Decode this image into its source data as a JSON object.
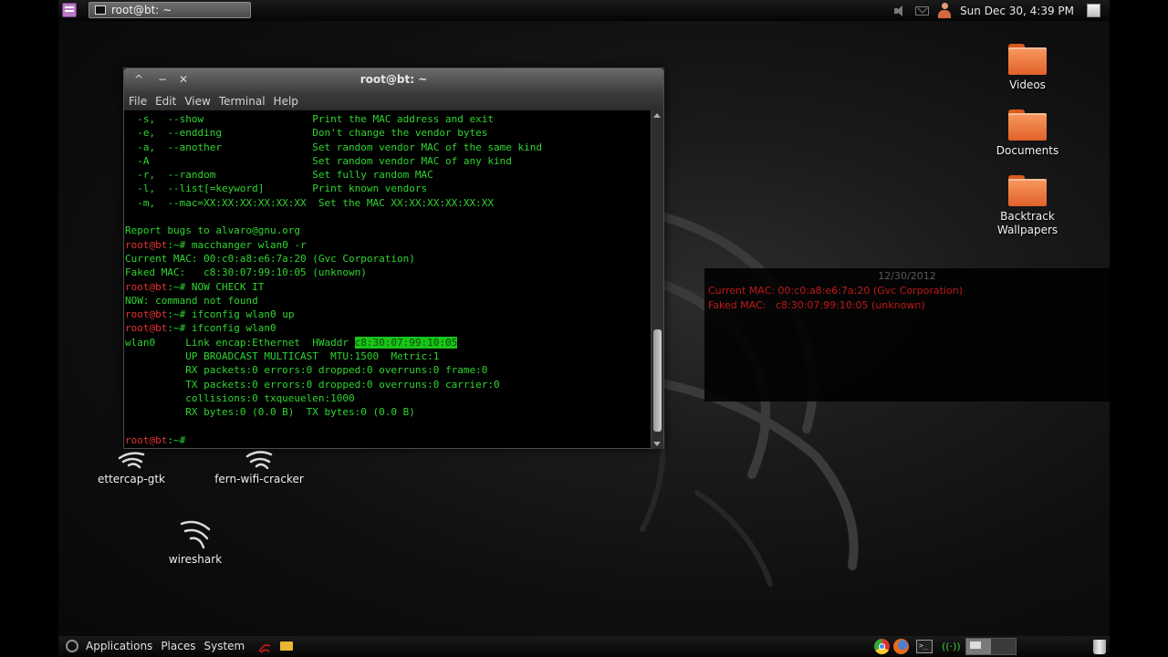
{
  "top_panel": {
    "taskbar_window": "root@bt: ~",
    "clock": "Sun Dec 30,  4:39 PM",
    "icons": [
      "menu-launcher-icon",
      "terminal-icon",
      "speaker-icon",
      "mail-icon",
      "user-icon",
      "show-desktop-icon"
    ]
  },
  "terminal": {
    "title": "root@bt: ~",
    "menu": [
      "File",
      "Edit",
      "View",
      "Terminal",
      "Help"
    ],
    "lines": [
      "  -s,  --show                  Print the MAC address and exit",
      "  -e,  --endding               Don't change the vendor bytes",
      "  -a,  --another               Set random vendor MAC of the same kind",
      "  -A                           Set random vendor MAC of any kind",
      "  -r,  --random                Set fully random MAC",
      "  -l,  --list[=keyword]        Print known vendors",
      "  -m,  --mac=XX:XX:XX:XX:XX:XX  Set the MAC XX:XX:XX:XX:XX:XX",
      "",
      "Report bugs to alvaro@gnu.org"
    ],
    "prompt": "root@bt",
    "prompt_suffix": ":~# ",
    "cmd1": "macchanger wlan0 -r",
    "out1": "Current MAC: 00:c0:a8:e6:7a:20 (Gvc Corporation)",
    "out2": "Faked MAC:   c8:30:07:99:10:05 (unknown)",
    "cmd2": "NOW CHECK IT",
    "out3": "NOW: command not found",
    "cmd3": "ifconfig wlan0 up",
    "cmd4": "ifconfig wlan0",
    "if_pre": "wlan0     Link encap:Ethernet  HWaddr ",
    "hwaddr": "c8:30:07:99:10:05",
    "if_lines": [
      "          UP BROADCAST MULTICAST  MTU:1500  Metric:1",
      "          RX packets:0 errors:0 dropped:0 overruns:0 frame:0",
      "          TX packets:0 errors:0 dropped:0 overruns:0 carrier:0",
      "          collisions:0 txqueuelen:1000",
      "          RX bytes:0 (0.0 B)  TX bytes:0 (0.0 B)"
    ]
  },
  "conky": {
    "date": "12/30/2012",
    "line1": "Current MAC: 00:c0:a8:e6:7a:20 (Gvc Corporation)",
    "line2": "Faked MAC:   c8:30:07:99:10:05 (unknown)"
  },
  "desktop_icons": {
    "videos": "Videos",
    "documents": "Documents",
    "backtrack_line1": "Backtrack",
    "backtrack_line2": "Wallpapers",
    "ettercap": "ettercap-gtk",
    "fern": "fern-wifi-cracker",
    "wireshark": "wireshark"
  },
  "bottom_panel": {
    "menu": [
      "Applications",
      "Places",
      "System"
    ]
  },
  "colors": {
    "terminal_text": "#2fd52f",
    "prompt": "#e33232",
    "highlight": "#18c418",
    "folder": "#f0843f"
  }
}
